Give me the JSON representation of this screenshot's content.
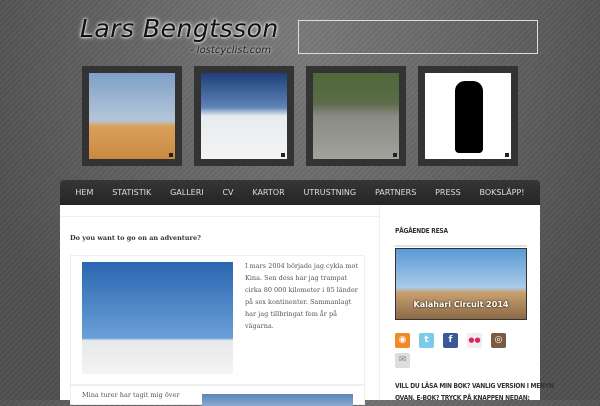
{
  "header": {
    "logo_name": "Lars Bengtsson",
    "logo_sub": "- lostcyclist.com"
  },
  "thumbnails": [
    {
      "name": "desert-cyclist"
    },
    {
      "name": "mountain-summit"
    },
    {
      "name": "packraft"
    },
    {
      "name": "hiker-silhouette"
    }
  ],
  "nav": [
    "HEM",
    "STATISTIK",
    "GALLERI",
    "CV",
    "KARTOR",
    "UTRUSTNING",
    "PARTNERS",
    "PRESS",
    "BOKSLÄPP!"
  ],
  "main": {
    "intro": "Do you want to go on an adventure?",
    "post1_lines": [
      "I mars 2004 började jag cykla mot",
      "Kina. Sen dess har jag trampat",
      "cirka 80 000 kilometer i 85 länder",
      "på sex kontinenter. Sammanlagt",
      "har jag tillbringat fem år på",
      "vägarna."
    ],
    "post2_line": "Mina turer har tagit mig över"
  },
  "sidebar": {
    "title": "PÅGÅENDE RESA",
    "trip_caption": "Kalahari Circuit 2014",
    "social": [
      "rss",
      "twitter",
      "facebook",
      "flickr",
      "instagram",
      "email"
    ],
    "book_heading_1": "VILL DU LÄSA MIN BOK? VANLIG VERSION I MENYN",
    "book_heading_2": "OVAN. E-BOK? TRYCK PÅ KNAPPEN NEDAN:"
  },
  "colors": {
    "nav": "#2b2b2b",
    "rss": "#f08a24",
    "twitter": "#5bc0de",
    "facebook": "#3b5998"
  }
}
